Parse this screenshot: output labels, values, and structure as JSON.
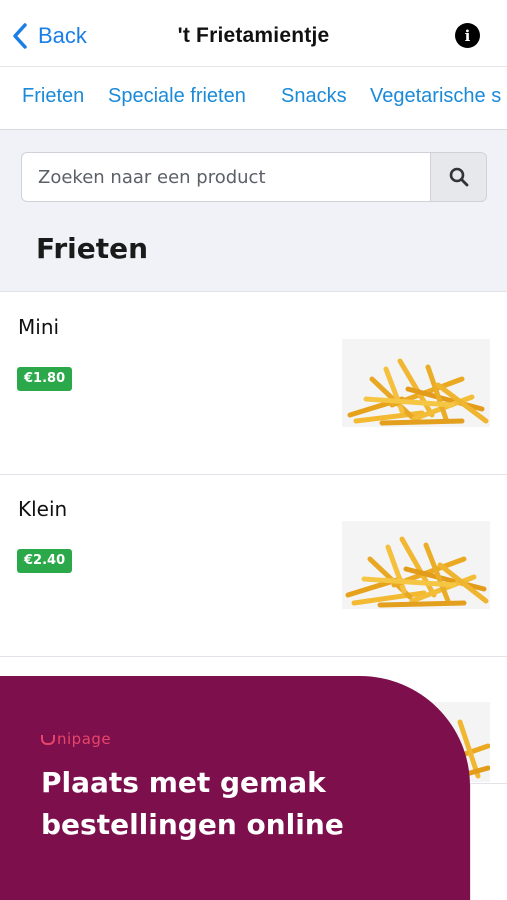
{
  "navbar": {
    "back_label": "Back",
    "title": "'t Frietamientje",
    "info_glyph": "i"
  },
  "tabs": [
    {
      "label": "Frieten"
    },
    {
      "label": "Speciale frieten"
    },
    {
      "label": "Snacks"
    },
    {
      "label": "Vegetarische s"
    }
  ],
  "search": {
    "placeholder": "Zoeken naar een product",
    "button_icon": "search-icon"
  },
  "section": {
    "title": "Frieten"
  },
  "products": [
    {
      "name": "Mini",
      "price": "€1.80",
      "image": "fries-image"
    },
    {
      "name": "Klein",
      "price": "€2.40",
      "image": "fries-image"
    }
  ],
  "promo": {
    "brand": "nipage",
    "headline_line1": "Plaats met gemak",
    "headline_line2": "bestellingen online",
    "background": "#7c0f4c",
    "brand_color": "#e8456a"
  },
  "colors": {
    "accent": "#1a7ee6",
    "price_badge": "#2aa84a"
  }
}
